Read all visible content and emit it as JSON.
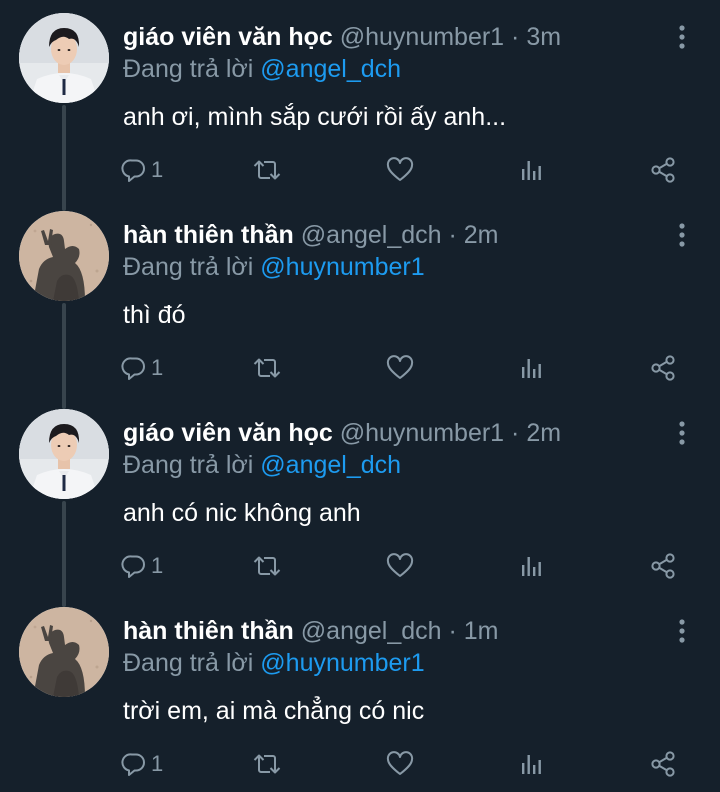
{
  "tweets": [
    {
      "author": "giáo viên văn học",
      "handle": "@huynumber1",
      "separator": "·",
      "time": "3m",
      "replying_prefix": "Đang trả lời",
      "replying_to": "@angel_dch",
      "text": "anh ơi, mình sắp cưới rồi ấy anh...",
      "reply_count": "1",
      "avatar_icon": "profile-photo-boy-in-uniform"
    },
    {
      "author": "hàn thiên thần",
      "handle": "@angel_dch",
      "separator": "·",
      "time": "2m",
      "replying_prefix": "Đang trả lời",
      "replying_to": "@huynumber1",
      "text": "thì đó",
      "reply_count": "1",
      "avatar_icon": "profile-photo-shadow-on-sand"
    },
    {
      "author": "giáo viên văn học",
      "handle": "@huynumber1",
      "separator": "·",
      "time": "2m",
      "replying_prefix": "Đang trả lời",
      "replying_to": "@angel_dch",
      "text": "anh có nic không anh",
      "reply_count": "1",
      "avatar_icon": "profile-photo-boy-in-uniform"
    },
    {
      "author": "hàn thiên thần",
      "handle": "@angel_dch",
      "separator": "·",
      "time": "1m",
      "replying_prefix": "Đang trả lời",
      "replying_to": "@huynumber1",
      "text": "trời em, ai mà chẳng có nic",
      "reply_count": "1",
      "avatar_icon": "profile-photo-shadow-on-sand"
    }
  ],
  "icons": {
    "reply": "reply-icon",
    "retweet": "retweet-icon",
    "like": "heart-icon",
    "stats": "analytics-icon",
    "share": "share-icon",
    "more": "more-vertical-icon"
  },
  "colors": {
    "background": "#15202b",
    "text_primary": "#ffffff",
    "text_secondary": "#8899a6",
    "mention": "#1d9bf0",
    "thread_line": "#38444d"
  }
}
